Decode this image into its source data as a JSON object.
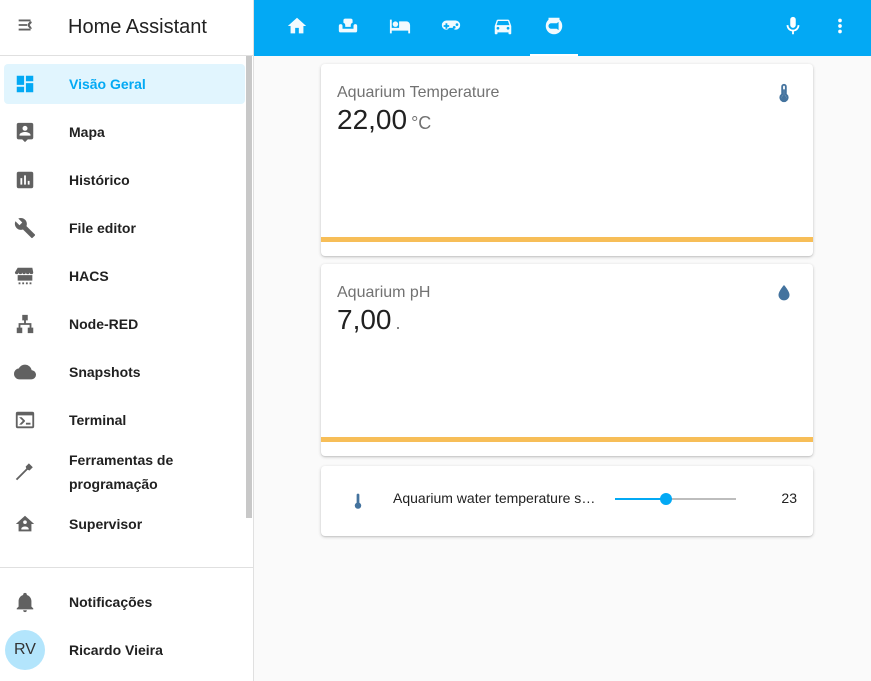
{
  "app": {
    "title": "Home Assistant"
  },
  "sidebar": {
    "items": [
      {
        "label": "Visão Geral",
        "icon": "dashboard-icon",
        "active": true
      },
      {
        "label": "Mapa",
        "icon": "map-icon"
      },
      {
        "label": "Histórico",
        "icon": "history-chart-icon"
      },
      {
        "label": "File editor",
        "icon": "wrench-icon"
      },
      {
        "label": "HACS",
        "icon": "hacs-store-icon"
      },
      {
        "label": "Node-RED",
        "icon": "sitemap-icon"
      },
      {
        "label": "Snapshots",
        "icon": "cloud-icon"
      },
      {
        "label": "Terminal",
        "icon": "terminal-icon"
      },
      {
        "label": "Ferramentas de programação",
        "icon": "hammer-icon"
      },
      {
        "label": "Supervisor",
        "icon": "supervisor-home-icon"
      }
    ],
    "notifications_label": "Notificações",
    "user": {
      "name": "Ricardo Vieira",
      "initials": "RV"
    }
  },
  "topbar": {
    "tabs": [
      "home-icon",
      "sofa-icon",
      "bed-icon",
      "gamepad-icon",
      "car-icon",
      "fishbowl-icon"
    ],
    "active_tab": 5,
    "right": [
      "microphone-icon",
      "more-vertical-icon"
    ],
    "accent": "#03a9f4"
  },
  "cards": [
    {
      "name": "Aquarium Temperature",
      "value": "22,00",
      "unit": "°C",
      "icon": "thermometer-icon"
    },
    {
      "name": "Aquarium pH",
      "value": "7,00",
      "unit": ".",
      "icon": "water-drop-icon"
    }
  ],
  "slider": {
    "label": "Aquarium water temperature setpoint",
    "value": "23",
    "fraction": 0.42,
    "icon": "thermometer-icon"
  },
  "colors": {
    "bar": "#f7be58",
    "icon": "#44739e"
  }
}
